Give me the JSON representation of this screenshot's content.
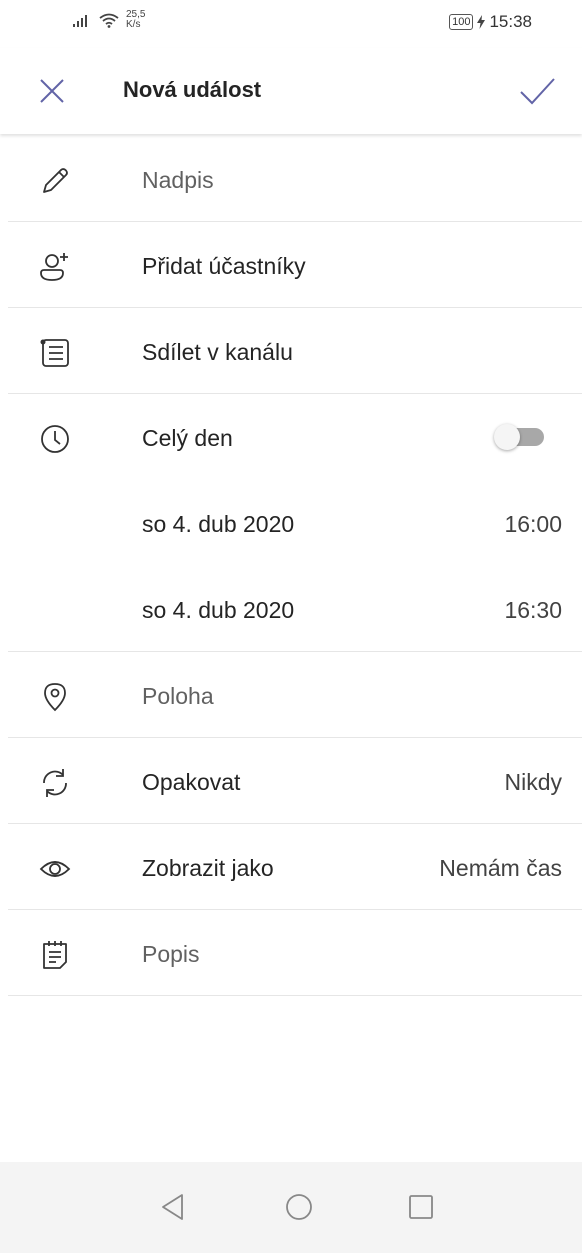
{
  "status_bar": {
    "speed_value": "25,5",
    "speed_unit": "K/s",
    "battery": "100",
    "time": "15:38"
  },
  "header": {
    "title": "Nová událost",
    "accent_color": "#6264a7"
  },
  "rows": {
    "title": {
      "placeholder": "Nadpis",
      "icon": "pencil-icon"
    },
    "attendees": {
      "label": "Přidat účastníky",
      "icon": "add-person-icon"
    },
    "channel": {
      "label": "Sdílet v kanálu",
      "icon": "channel-list-icon"
    },
    "all_day": {
      "label": "Celý den",
      "icon": "clock-icon",
      "toggle_on": false
    },
    "start": {
      "date": "so 4. dub 2020",
      "time": "16:00"
    },
    "end": {
      "date": "so 4. dub 2020",
      "time": "16:30"
    },
    "location": {
      "placeholder": "Poloha",
      "icon": "location-pin-icon"
    },
    "repeat": {
      "label": "Opakovat",
      "value": "Nikdy",
      "icon": "repeat-icon"
    },
    "show_as": {
      "label": "Zobrazit jako",
      "value": "Nemám čas",
      "icon": "eye-icon"
    },
    "description": {
      "placeholder": "Popis",
      "icon": "notepad-icon"
    }
  }
}
